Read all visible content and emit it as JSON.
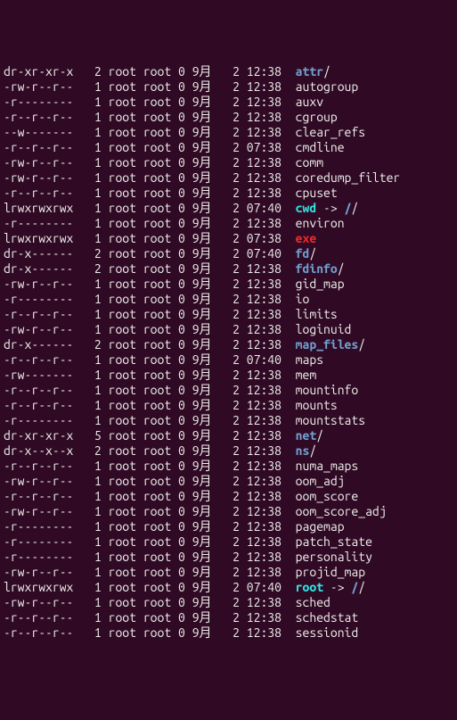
{
  "listing": [
    {
      "perms": "dr-xr-xr-x",
      "links": "2",
      "owner": "root",
      "group": "root",
      "size": "0",
      "month": "9月",
      "day": "2",
      "time": "12:38",
      "name": "attr",
      "name_color": "blue",
      "suffix": "/",
      "suffix_color": "white"
    },
    {
      "perms": "-rw-r--r--",
      "links": "1",
      "owner": "root",
      "group": "root",
      "size": "0",
      "month": "9月",
      "day": "2",
      "time": "12:38",
      "name": "autogroup",
      "name_color": "white"
    },
    {
      "perms": "-r--------",
      "links": "1",
      "owner": "root",
      "group": "root",
      "size": "0",
      "month": "9月",
      "day": "2",
      "time": "12:38",
      "name": "auxv",
      "name_color": "white"
    },
    {
      "perms": "-r--r--r--",
      "links": "1",
      "owner": "root",
      "group": "root",
      "size": "0",
      "month": "9月",
      "day": "2",
      "time": "12:38",
      "name": "cgroup",
      "name_color": "white"
    },
    {
      "perms": "--w-------",
      "links": "1",
      "owner": "root",
      "group": "root",
      "size": "0",
      "month": "9月",
      "day": "2",
      "time": "12:38",
      "name": "clear_refs",
      "name_color": "white"
    },
    {
      "perms": "-r--r--r--",
      "links": "1",
      "owner": "root",
      "group": "root",
      "size": "0",
      "month": "9月",
      "day": "2",
      "time": "07:38",
      "name": "cmdline",
      "name_color": "white"
    },
    {
      "perms": "-rw-r--r--",
      "links": "1",
      "owner": "root",
      "group": "root",
      "size": "0",
      "month": "9月",
      "day": "2",
      "time": "12:38",
      "name": "comm",
      "name_color": "white"
    },
    {
      "perms": "-rw-r--r--",
      "links": "1",
      "owner": "root",
      "group": "root",
      "size": "0",
      "month": "9月",
      "day": "2",
      "time": "12:38",
      "name": "coredump_filter",
      "name_color": "white"
    },
    {
      "perms": "-r--r--r--",
      "links": "1",
      "owner": "root",
      "group": "root",
      "size": "0",
      "month": "9月",
      "day": "2",
      "time": "12:38",
      "name": "cpuset",
      "name_color": "white"
    },
    {
      "perms": "lrwxrwxrwx",
      "links": "1",
      "owner": "root",
      "group": "root",
      "size": "0",
      "month": "9月",
      "day": "2",
      "time": "07:40",
      "name": "cwd",
      "name_color": "cyan",
      "arrow": " -> ",
      "target": "/",
      "target_color": "blue",
      "target_suffix": "/",
      "target_suffix_color": "white"
    },
    {
      "perms": "-r--------",
      "links": "1",
      "owner": "root",
      "group": "root",
      "size": "0",
      "month": "9月",
      "day": "2",
      "time": "12:38",
      "name": "environ",
      "name_color": "white"
    },
    {
      "perms": "lrwxrwxrwx",
      "links": "1",
      "owner": "root",
      "group": "root",
      "size": "0",
      "month": "9月",
      "day": "2",
      "time": "07:38",
      "name": "exe",
      "name_color": "red"
    },
    {
      "perms": "dr-x------",
      "links": "2",
      "owner": "root",
      "group": "root",
      "size": "0",
      "month": "9月",
      "day": "2",
      "time": "07:40",
      "name": "fd",
      "name_color": "blue",
      "suffix": "/",
      "suffix_color": "white"
    },
    {
      "perms": "dr-x------",
      "links": "2",
      "owner": "root",
      "group": "root",
      "size": "0",
      "month": "9月",
      "day": "2",
      "time": "12:38",
      "name": "fdinfo",
      "name_color": "blue",
      "suffix": "/",
      "suffix_color": "white"
    },
    {
      "perms": "-rw-r--r--",
      "links": "1",
      "owner": "root",
      "group": "root",
      "size": "0",
      "month": "9月",
      "day": "2",
      "time": "12:38",
      "name": "gid_map",
      "name_color": "white"
    },
    {
      "perms": "-r--------",
      "links": "1",
      "owner": "root",
      "group": "root",
      "size": "0",
      "month": "9月",
      "day": "2",
      "time": "12:38",
      "name": "io",
      "name_color": "white"
    },
    {
      "perms": "-r--r--r--",
      "links": "1",
      "owner": "root",
      "group": "root",
      "size": "0",
      "month": "9月",
      "day": "2",
      "time": "12:38",
      "name": "limits",
      "name_color": "white"
    },
    {
      "perms": "-rw-r--r--",
      "links": "1",
      "owner": "root",
      "group": "root",
      "size": "0",
      "month": "9月",
      "day": "2",
      "time": "12:38",
      "name": "loginuid",
      "name_color": "white"
    },
    {
      "perms": "dr-x------",
      "links": "2",
      "owner": "root",
      "group": "root",
      "size": "0",
      "month": "9月",
      "day": "2",
      "time": "12:38",
      "name": "map_files",
      "name_color": "blue",
      "suffix": "/",
      "suffix_color": "white"
    },
    {
      "perms": "-r--r--r--",
      "links": "1",
      "owner": "root",
      "group": "root",
      "size": "0",
      "month": "9月",
      "day": "2",
      "time": "07:40",
      "name": "maps",
      "name_color": "white"
    },
    {
      "perms": "-rw-------",
      "links": "1",
      "owner": "root",
      "group": "root",
      "size": "0",
      "month": "9月",
      "day": "2",
      "time": "12:38",
      "name": "mem",
      "name_color": "white"
    },
    {
      "perms": "-r--r--r--",
      "links": "1",
      "owner": "root",
      "group": "root",
      "size": "0",
      "month": "9月",
      "day": "2",
      "time": "12:38",
      "name": "mountinfo",
      "name_color": "white"
    },
    {
      "perms": "-r--r--r--",
      "links": "1",
      "owner": "root",
      "group": "root",
      "size": "0",
      "month": "9月",
      "day": "2",
      "time": "12:38",
      "name": "mounts",
      "name_color": "white"
    },
    {
      "perms": "-r--------",
      "links": "1",
      "owner": "root",
      "group": "root",
      "size": "0",
      "month": "9月",
      "day": "2",
      "time": "12:38",
      "name": "mountstats",
      "name_color": "white"
    },
    {
      "perms": "dr-xr-xr-x",
      "links": "5",
      "owner": "root",
      "group": "root",
      "size": "0",
      "month": "9月",
      "day": "2",
      "time": "12:38",
      "name": "net",
      "name_color": "blue",
      "suffix": "/",
      "suffix_color": "white"
    },
    {
      "perms": "dr-x--x--x",
      "links": "2",
      "owner": "root",
      "group": "root",
      "size": "0",
      "month": "9月",
      "day": "2",
      "time": "12:38",
      "name": "ns",
      "name_color": "blue",
      "suffix": "/",
      "suffix_color": "white"
    },
    {
      "perms": "-r--r--r--",
      "links": "1",
      "owner": "root",
      "group": "root",
      "size": "0",
      "month": "9月",
      "day": "2",
      "time": "12:38",
      "name": "numa_maps",
      "name_color": "white"
    },
    {
      "perms": "-rw-r--r--",
      "links": "1",
      "owner": "root",
      "group": "root",
      "size": "0",
      "month": "9月",
      "day": "2",
      "time": "12:38",
      "name": "oom_adj",
      "name_color": "white"
    },
    {
      "perms": "-r--r--r--",
      "links": "1",
      "owner": "root",
      "group": "root",
      "size": "0",
      "month": "9月",
      "day": "2",
      "time": "12:38",
      "name": "oom_score",
      "name_color": "white"
    },
    {
      "perms": "-rw-r--r--",
      "links": "1",
      "owner": "root",
      "group": "root",
      "size": "0",
      "month": "9月",
      "day": "2",
      "time": "12:38",
      "name": "oom_score_adj",
      "name_color": "white"
    },
    {
      "perms": "-r--------",
      "links": "1",
      "owner": "root",
      "group": "root",
      "size": "0",
      "month": "9月",
      "day": "2",
      "time": "12:38",
      "name": "pagemap",
      "name_color": "white"
    },
    {
      "perms": "-r--------",
      "links": "1",
      "owner": "root",
      "group": "root",
      "size": "0",
      "month": "9月",
      "day": "2",
      "time": "12:38",
      "name": "patch_state",
      "name_color": "white"
    },
    {
      "perms": "-r--------",
      "links": "1",
      "owner": "root",
      "group": "root",
      "size": "0",
      "month": "9月",
      "day": "2",
      "time": "12:38",
      "name": "personality",
      "name_color": "white"
    },
    {
      "perms": "-rw-r--r--",
      "links": "1",
      "owner": "root",
      "group": "root",
      "size": "0",
      "month": "9月",
      "day": "2",
      "time": "12:38",
      "name": "projid_map",
      "name_color": "white"
    },
    {
      "perms": "lrwxrwxrwx",
      "links": "1",
      "owner": "root",
      "group": "root",
      "size": "0",
      "month": "9月",
      "day": "2",
      "time": "07:40",
      "name": "root",
      "name_color": "cyan",
      "arrow": " -> ",
      "target": "/",
      "target_color": "blue",
      "target_suffix": "/",
      "target_suffix_color": "white"
    },
    {
      "perms": "-rw-r--r--",
      "links": "1",
      "owner": "root",
      "group": "root",
      "size": "0",
      "month": "9月",
      "day": "2",
      "time": "12:38",
      "name": "sched",
      "name_color": "white"
    },
    {
      "perms": "-r--r--r--",
      "links": "1",
      "owner": "root",
      "group": "root",
      "size": "0",
      "month": "9月",
      "day": "2",
      "time": "12:38",
      "name": "schedstat",
      "name_color": "white"
    },
    {
      "perms": "-r--r--r--",
      "links": "1",
      "owner": "root",
      "group": "root",
      "size": "0",
      "month": "9月",
      "day": "2",
      "time": "12:38",
      "name": "sessionid",
      "name_color": "white"
    }
  ]
}
